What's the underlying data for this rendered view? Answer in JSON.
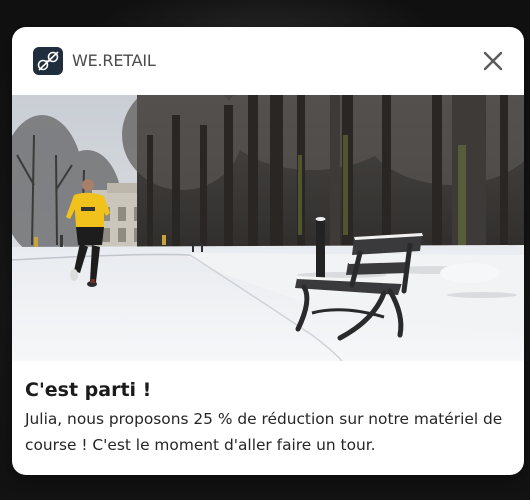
{
  "notification": {
    "app_name": "WE.RETAIL",
    "app_icon": "we-retail-logo-icon",
    "close_icon": "close-icon",
    "image_subject": "jogger-in-snowy-park-photo",
    "title": "C'est parti !",
    "message": "Julia, nous proposons 25 % de réduction sur notre matériel de course ! C'est le moment d'aller faire un tour."
  },
  "colors": {
    "card_background": "#ffffff",
    "app_icon_background": "#1f2d3c",
    "app_name_text": "#4b4b4b",
    "title_text": "#1b1b1b",
    "message_text": "#262626",
    "screen_background": "#141414"
  }
}
